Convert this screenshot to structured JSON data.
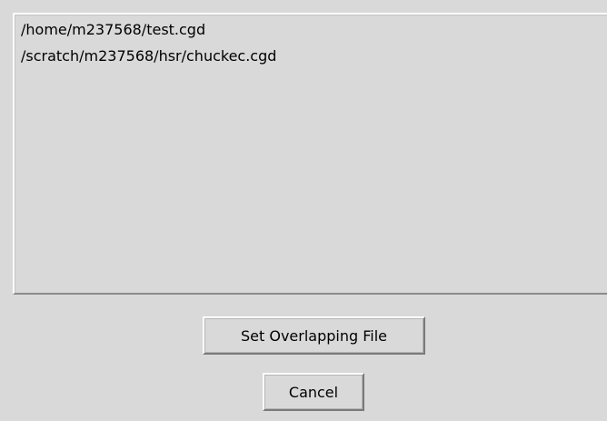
{
  "listbox": {
    "items": [
      "/home/m237568/test.cgd",
      "/scratch/m237568/hsr/chuckec.cgd"
    ]
  },
  "buttons": {
    "set_overlapping_label": "Set Overlapping File",
    "cancel_label": "Cancel"
  }
}
